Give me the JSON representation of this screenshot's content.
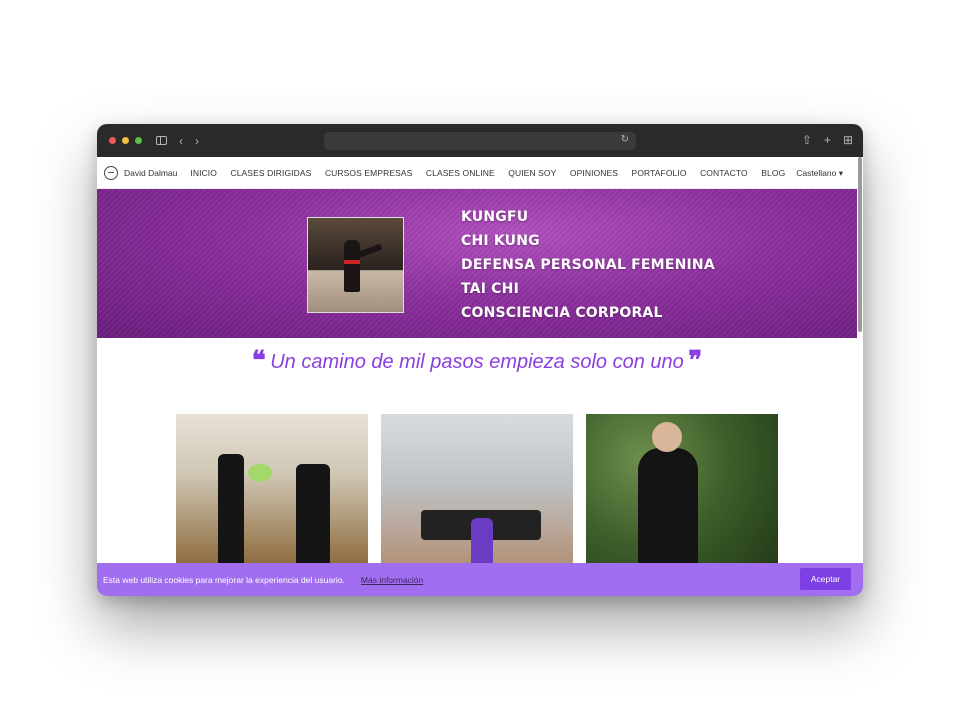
{
  "browser": {
    "reload_icon": "↻",
    "back_icon": "‹",
    "forward_icon": "›",
    "share_icon": "⇧",
    "newtab_icon": "+",
    "tabs_icon": "⊞"
  },
  "nav": {
    "brand": "David Dalmau",
    "items": [
      "INICIO",
      "CLASES DIRIGIDAS",
      "CURSOS EMPRESAS",
      "CLASES ONLINE",
      "QUIEN SOY",
      "OPINIONES",
      "PORTAFOLIO",
      "CONTACTO",
      "BLOG"
    ],
    "language": "Castellano ▾"
  },
  "hero": {
    "disciplines": [
      "KUNGFU",
      "CHI KUNG",
      "DEFENSA PERSONAL FEMENINA",
      "TAI CHI",
      "CONSCIENCIA CORPORAL"
    ]
  },
  "quote": {
    "open_mark": "❝",
    "text": "Un camino de mil pasos empieza solo con uno",
    "close_mark": "❞"
  },
  "cookie": {
    "message": "Esta web utiliza cookies para mejorar la experiencia del usuario.",
    "link": "Más información",
    "accept": "Aceptar"
  },
  "colors": {
    "accent": "#8a3fe0",
    "cookie_bar": "#a26ef0",
    "accept_button": "#7c3fe4"
  }
}
